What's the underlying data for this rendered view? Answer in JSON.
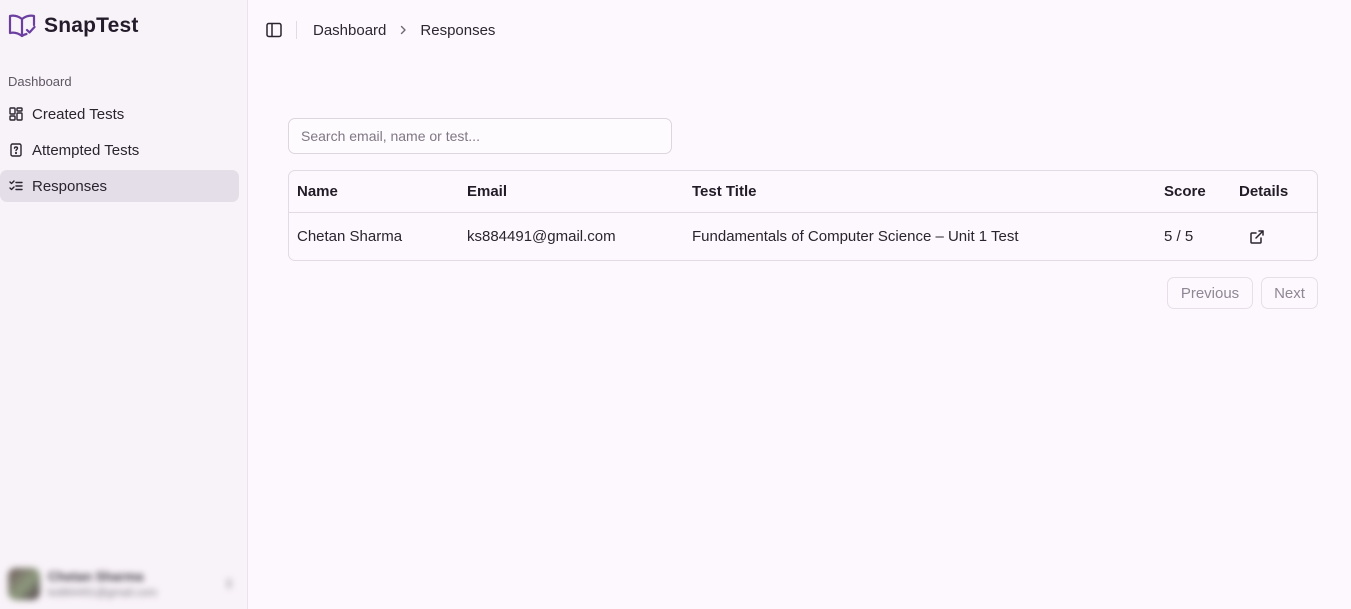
{
  "app": {
    "name": "SnapTest",
    "accent": "#6b3fa0"
  },
  "sidebar": {
    "section_label": "Dashboard",
    "items": [
      {
        "label": "Created Tests",
        "icon": "layout-grid-icon",
        "active": false
      },
      {
        "label": "Attempted Tests",
        "icon": "file-question-icon",
        "active": false
      },
      {
        "label": "Responses",
        "icon": "list-checks-icon",
        "active": true
      }
    ],
    "user": {
      "name": "Chetan Sharma",
      "email": "ks884491@gmail.com",
      "blurred": true
    }
  },
  "breadcrumb": {
    "parent": "Dashboard",
    "current": "Responses"
  },
  "search": {
    "placeholder": "Search email, name or test...",
    "value": ""
  },
  "table": {
    "headers": [
      "Name",
      "Email",
      "Test Title",
      "Score",
      "Details"
    ],
    "rows": [
      {
        "name": "Chetan Sharma",
        "email": "ks884491@gmail.com",
        "test_title": "Fundamentals of Computer Science – Unit 1 Test",
        "score": "5 / 5",
        "details_icon": "external-link-icon"
      }
    ]
  },
  "pagination": {
    "previous_label": "Previous",
    "next_label": "Next",
    "previous_disabled": true,
    "next_disabled": true
  }
}
